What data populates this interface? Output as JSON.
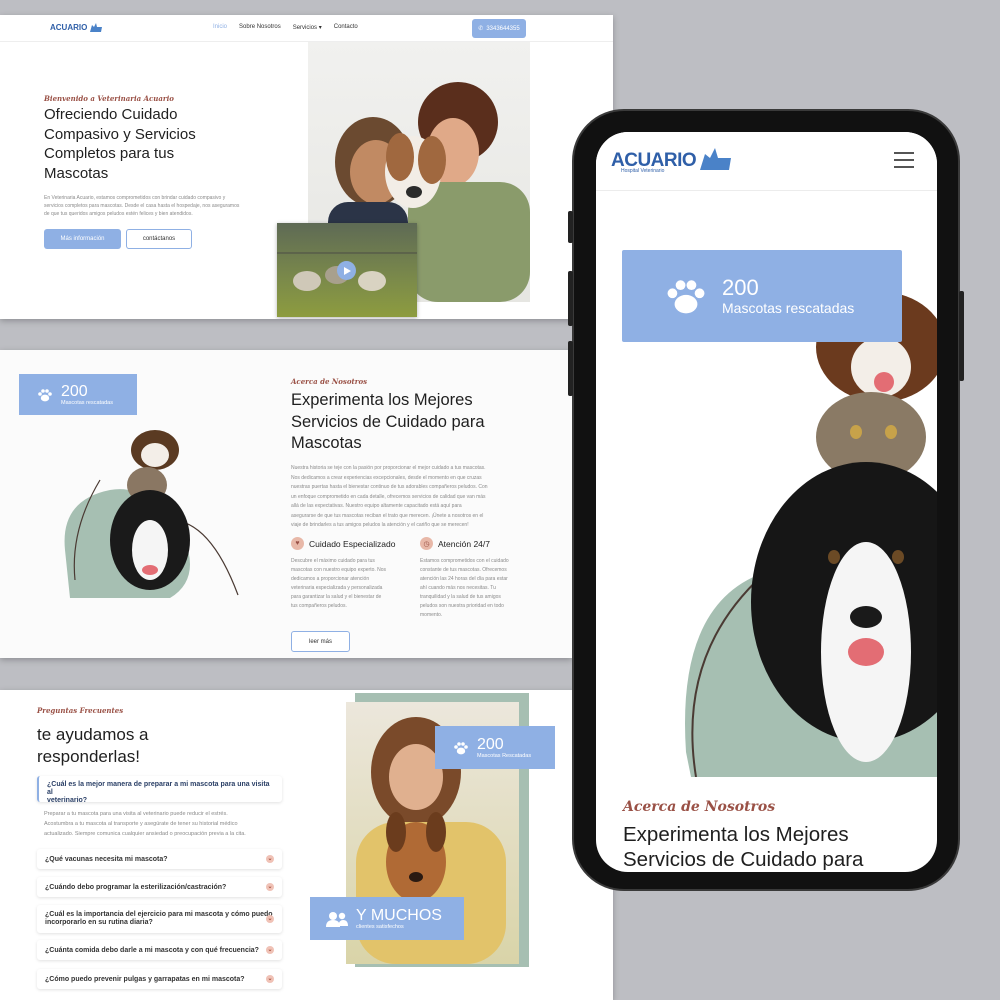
{
  "nav": {
    "logo_text": "ACUARIO",
    "logo_sub": "Hospital Veterinario",
    "items": [
      "Inicio",
      "Sobre Nosotros",
      "Servicios",
      "Contacto"
    ],
    "phone": "3343644355"
  },
  "hero": {
    "eyebrow": "Bienvenido a Veterinaria Acuario",
    "title_lines": [
      "Ofreciendo Cuidado",
      "Compasivo y Servicios",
      "Completos para tus",
      "Mascotas"
    ],
    "body_lines": [
      "En Veterinaria Acuario, estamos comprometidos con brindar cuidado compasivo y",
      "servicios completos para mascotas. Desde el casa hasta el hospedaje, nos aseguramos",
      "de que tus queridos amigos peludos estén felices y bien atendidos."
    ],
    "btn_more": "Más información",
    "btn_contact": "contáctanos"
  },
  "about": {
    "stat_number": "200",
    "stat_label": "Mascotas rescatadas",
    "eyebrow": "Acerca de Nosotros",
    "title_lines": [
      "Experimenta los Mejores",
      "Servicios de Cuidado para",
      "Mascotas"
    ],
    "body_lines": [
      "Nuestra historia se teje con la pasión por proporcionar el mejor cuidado a tus mascotas.",
      "Nos dedicamos a crear experiencias excepcionales, desde el momento en que cruzas",
      "nuestras puertas hasta el bienestar continuo de tus adorables compañeros peludos. Con",
      "un enfoque comprometido en cada detalle, ofrecemos servicios de calidad que van más",
      "allá de las expectativas. Nuestro equipo altamente capacitado está aquí para",
      "asegurarse de que tus mascotas reciban el trato que merecen. ¡Únete a nosotros en el",
      "viaje de brindarles a tus amigos peludos la atención y el cariño que se merecen!"
    ],
    "feature1_title": "Cuidado Especializado",
    "feature1_lines": [
      "Descubre el máximo cuidado para tus",
      "mascotas con nuestro equipo experto. Nos",
      "dedicamos a proporcionar atención",
      "veterinaria especializada y personalizada",
      "para garantizar la salud y el bienestar de",
      "tus compañeros peludos."
    ],
    "feature2_title": "Atención 24/7",
    "feature2_lines": [
      "Estamos comprometidos con el cuidado",
      "constante de tus mascotas. Ofrecemos",
      "atención las 24 horas del día para estar",
      "ahí cuando más nos necesitas. Tu",
      "tranquilidad y la salud de tus amigos",
      "peludos son nuestra prioridad en todo",
      "momento."
    ],
    "btn_more": "leer más"
  },
  "faq": {
    "eyebrow": "Preguntas Frecuentes",
    "title_lines": [
      "te ayudamos a",
      "responderlas!"
    ],
    "open_question_lines": [
      "¿Cuál es la mejor manera de preparar a mi mascota para una visita al",
      "veterinario?"
    ],
    "open_answer_lines": [
      "Preparar a tu mascota para una visita al veterinario puede reducir el estrés.",
      "Acostumbra a tu mascota al transporte y asegúrate de tener su historial médico",
      "actualizado. Siempre comunica cualquier ansiedad o preocupación previa a la cita."
    ],
    "q2": "¿Qué vacunas necesita mi mascota?",
    "q3": "¿Cuándo debo programar la esterilización/castración?",
    "q4_lines": [
      "¿Cuál es la importancia del ejercicio para mi mascota y cómo puedo",
      "incorporarlo en su rutina diaria?"
    ],
    "q5": "¿Cuánta comida debo darle a mi mascota y con qué frecuencia?",
    "q6": "¿Cómo puedo prevenir pulgas y garrapatas en mi mascota?",
    "badge1_number": "200",
    "badge1_label": "Mascotas Rescatadas",
    "badge2_title": "Y MUCHOS",
    "badge2_label": "clientes satisfechos"
  },
  "phone": {
    "logo_text": "ACUARIO",
    "logo_sub": "Hospital Veterinario",
    "stat_number": "200",
    "stat_label": "Mascotas rescatadas",
    "eyebrow": "Acerca de Nosotros",
    "title_lines": [
      "Experimenta los Mejores",
      "Servicios de Cuidado para"
    ]
  },
  "colors": {
    "accent_blue": "#8fb0e4",
    "accent_rust": "#9a5146",
    "sage": "#a6bfb2",
    "background": "#bdbec3"
  },
  "icons": [
    "phone-icon",
    "play-icon",
    "paw-icon",
    "users-icon",
    "chevron-down-icon",
    "menu-icon"
  ]
}
